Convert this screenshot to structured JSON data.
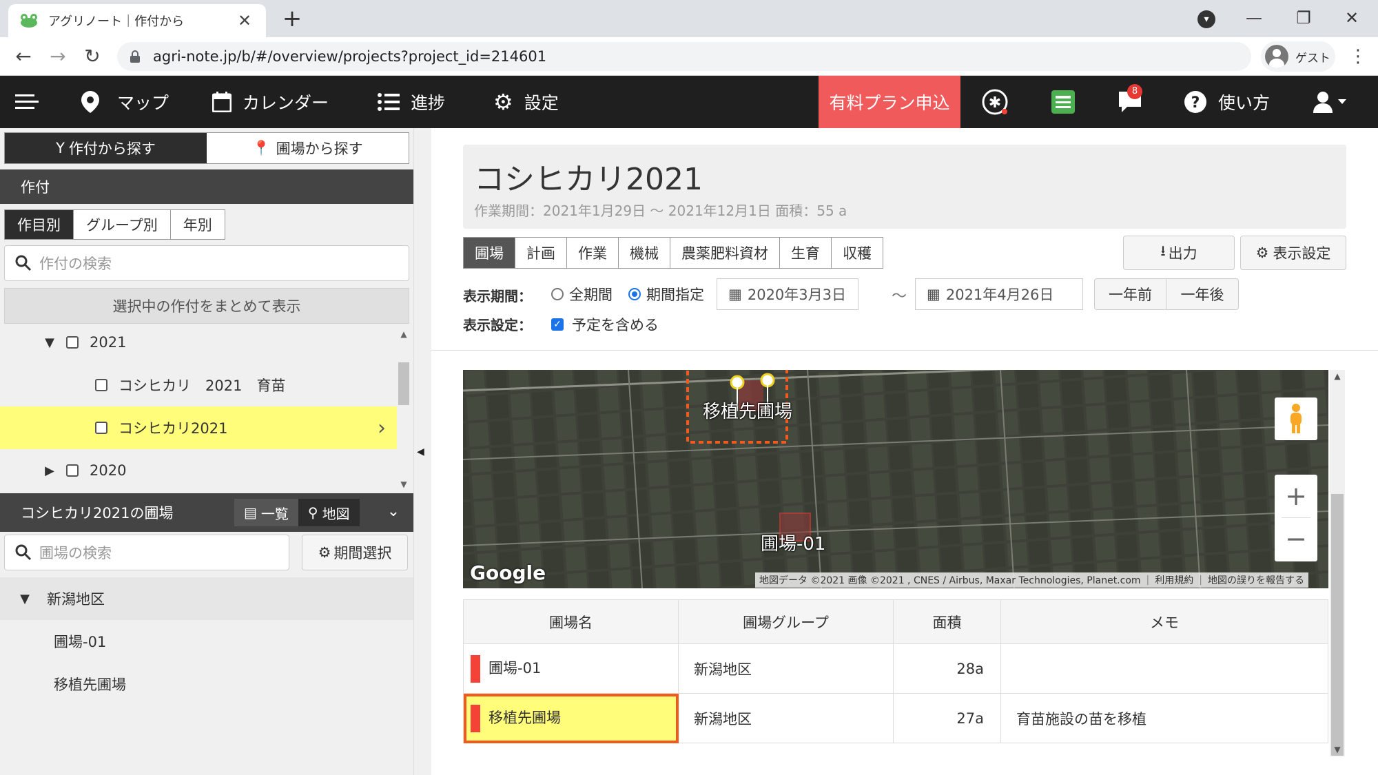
{
  "browser": {
    "tab_title": "アグリノート｜作付から",
    "url": "agri-note.jp/b/#/overview/projects?project_id=214601",
    "profile_label": "ゲスト"
  },
  "header": {
    "nav": [
      {
        "label": "マップ",
        "icon": "map-pin-icon"
      },
      {
        "label": "カレンダー",
        "icon": "calendar-icon"
      },
      {
        "label": "進捗",
        "icon": "list-icon"
      },
      {
        "label": "設定",
        "icon": "gear-icon"
      }
    ],
    "paid_plan_label": "有料プラン申込",
    "notification_count": "8",
    "help_label": "使い方"
  },
  "left": {
    "search_tabs": [
      "作付から探す",
      "圃場から探す"
    ],
    "crop_section_title": "作付",
    "sub_tabs": [
      "作目別",
      "グループ別",
      "年別"
    ],
    "crop_search_placeholder": "作付の検索",
    "show_selected_label": "選択中の作付をまとめて表示",
    "tree": [
      {
        "label": "2021",
        "expanded": true
      },
      {
        "label": "コシヒカリ　2021　育苗"
      },
      {
        "label": "コシヒカリ2021",
        "selected": true
      },
      {
        "label": "2020",
        "expanded": false
      }
    ],
    "fields_title": "コシヒカリ2021の圃場",
    "view_toggle": [
      "一覧",
      "地図"
    ],
    "field_search_placeholder": "圃場の検索",
    "period_select_label": "期間選択",
    "region": "新潟地区",
    "fields": [
      "圃場-01",
      "移植先圃場"
    ]
  },
  "main": {
    "title": "コシヒカリ2021",
    "meta": "作業期間：2021年1月29日 ～ 2021年12月1日  面積：55 a",
    "tabs": [
      "圃場",
      "計画",
      "作業",
      "機械",
      "農薬肥料資材",
      "生育",
      "収穫"
    ],
    "export_label": "出力",
    "display_settings_label": "表示設定",
    "period_label": "表示期間：",
    "period_options": [
      "全期間",
      "期間指定"
    ],
    "date_from": "2020年3月3日",
    "date_tilde": "～",
    "date_to": "2021年4月26日",
    "prev_year": "一年前",
    "next_year": "一年後",
    "settings_label": "表示設定：",
    "include_plan_label": "予定を含める",
    "map": {
      "labels": [
        "移植先圃場",
        "圃場-01"
      ],
      "google": "Google",
      "attribution": "地図データ ©2021 画像 ©2021 , CNES / Airbus, Maxar Technologies, Planet.com",
      "terms": "利用規約",
      "report": "地図の誤りを報告する"
    },
    "table": {
      "headers": [
        "圃場名",
        "圃場グループ",
        "面積",
        "メモ"
      ],
      "rows": [
        {
          "name": "圃場-01",
          "group": "新潟地区",
          "area": "28a",
          "memo": ""
        },
        {
          "name": "移植先圃場",
          "group": "新潟地区",
          "area": "27a",
          "memo": "育苗施設の苗を移植"
        }
      ]
    }
  },
  "colors": {
    "header_bg": "#1f1f1f",
    "paid_plan_bg": "#f15a5a",
    "selected_row": "#fffd7a",
    "highlight_border": "#f05a1e",
    "field_marker": "#f44336"
  }
}
